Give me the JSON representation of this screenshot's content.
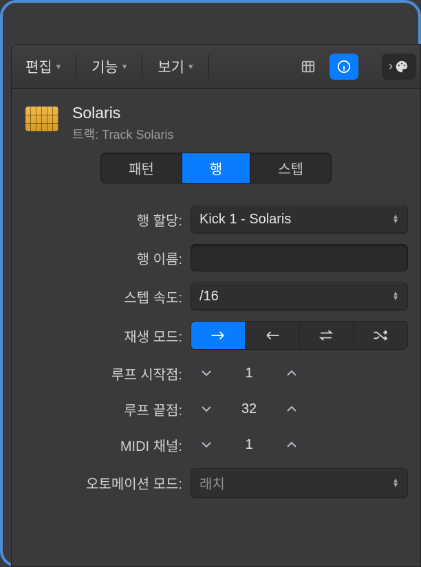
{
  "toolbar": {
    "menus": [
      "편집",
      "기능",
      "보기"
    ]
  },
  "header": {
    "title": "Solaris",
    "track_prefix": "트랙: ",
    "track_name": "Track Solaris"
  },
  "tabs": {
    "items": [
      "패턴",
      "행",
      "스텝"
    ],
    "selected_index": 1
  },
  "form": {
    "row_assignment": {
      "label": "행 할당:",
      "value": "Kick 1 - Solaris"
    },
    "row_name": {
      "label": "행 이름:",
      "value": ""
    },
    "step_rate": {
      "label": "스텝 속도:",
      "value": "/16"
    },
    "play_mode": {
      "label": "재생 모드:",
      "selected_index": 0,
      "options": [
        "forward",
        "backward",
        "pingpong",
        "random"
      ]
    },
    "loop_start": {
      "label": "루프 시작점:",
      "value": 1
    },
    "loop_end": {
      "label": "루프 끝점:",
      "value": 32
    },
    "midi_channel": {
      "label": "MIDI 채널:",
      "value": 1
    },
    "automation_mode": {
      "label": "오토메이션 모드:",
      "value": "래치"
    }
  },
  "icons": {
    "grid": "grid-icon",
    "info": "info-icon",
    "palette": "palette-icon"
  },
  "colors": {
    "accent": "#0a7cff",
    "bg": "#3a3a3c"
  }
}
